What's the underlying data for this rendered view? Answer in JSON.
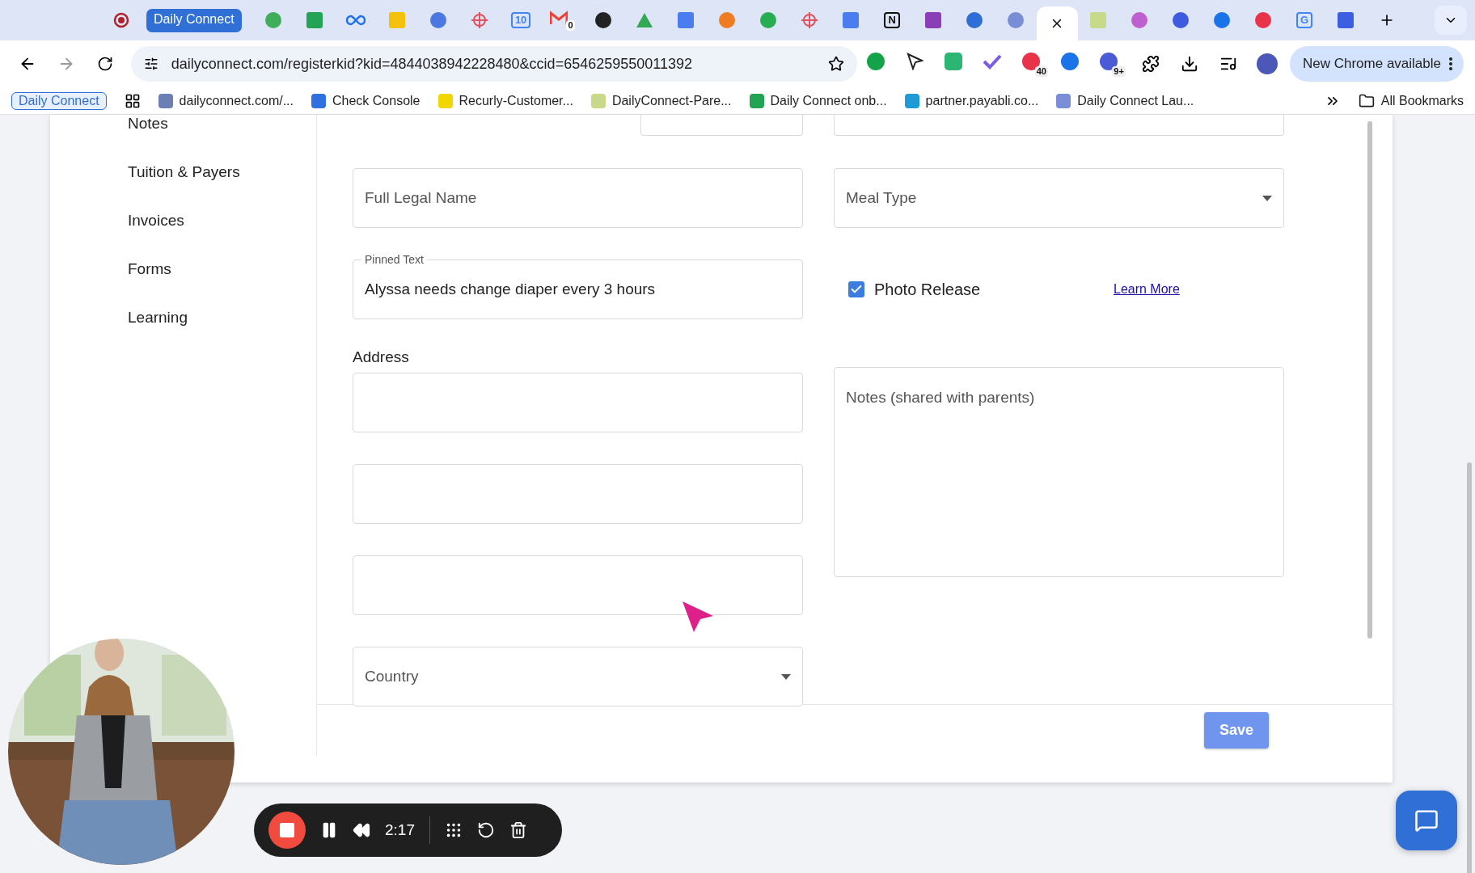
{
  "browser": {
    "tabs": [
      {
        "kind": "record",
        "color": "#b3202c"
      },
      {
        "kind": "group",
        "label": "Daily Connect"
      },
      {
        "kind": "circle",
        "color": "#3fae5a"
      },
      {
        "kind": "square",
        "color": "#23a455"
      },
      {
        "kind": "infinity",
        "color": "#1d6ff2"
      },
      {
        "kind": "square",
        "color": "#f4c20d"
      },
      {
        "kind": "circle",
        "color": "#4a78e0"
      },
      {
        "kind": "cross",
        "color": "#e0525e"
      },
      {
        "kind": "glyph",
        "color": "#4285f4",
        "glyph": "10"
      },
      {
        "kind": "mail",
        "color": "#ea4335",
        "glyph": "0"
      },
      {
        "kind": "circle",
        "color": "#222222"
      },
      {
        "kind": "triangle",
        "color": "#34a853"
      },
      {
        "kind": "square",
        "color": "#4a7ef0"
      },
      {
        "kind": "circle",
        "color": "#f07c22"
      },
      {
        "kind": "circle",
        "color": "#27ae52"
      },
      {
        "kind": "cross",
        "color": "#e0525e"
      },
      {
        "kind": "square",
        "color": "#4a7ef0"
      },
      {
        "kind": "glyph",
        "color": "#111111",
        "glyph": "N"
      },
      {
        "kind": "square",
        "color": "#8a3fb8"
      },
      {
        "kind": "circle",
        "color": "#2d6fd6"
      },
      {
        "kind": "circle",
        "color": "#7a8ed8"
      },
      {
        "kind": "active"
      },
      {
        "kind": "square",
        "color": "#c9d98a"
      },
      {
        "kind": "circle",
        "color": "#c05fd0"
      },
      {
        "kind": "circle",
        "color": "#3d5be0"
      },
      {
        "kind": "circle",
        "color": "#1a73e8"
      },
      {
        "kind": "circle",
        "color": "#e8334a"
      },
      {
        "kind": "glyph",
        "color": "#4285f4",
        "glyph": "G"
      },
      {
        "kind": "square",
        "color": "#3b5fe0"
      }
    ],
    "url": "dailyconnect.com/registerkid?kid=4844038942228480&ccid=6546259550011392",
    "extensions": [
      {
        "kind": "circle",
        "color": "#15a34a"
      },
      {
        "kind": "pointer",
        "color": "#222222"
      },
      {
        "kind": "square",
        "color": "#2bb673"
      },
      {
        "kind": "check",
        "color": "#7b5ce6"
      },
      {
        "kind": "circle",
        "color": "#e8334a",
        "badge": "40"
      },
      {
        "kind": "circle",
        "color": "#1a73e8"
      },
      {
        "kind": "circle",
        "color": "#4b5bd6",
        "badge": "9+"
      }
    ],
    "update_button": "New Chrome available",
    "bookmarks": [
      {
        "kind": "group",
        "label": "Daily Connect"
      },
      {
        "kind": "site",
        "label": "dailyconnect.com/...",
        "color": "#6b7fb5"
      },
      {
        "kind": "site",
        "label": "Check Console",
        "color": "#2f6fe0"
      },
      {
        "kind": "site",
        "label": "Recurly-Customer...",
        "color": "#f2d600"
      },
      {
        "kind": "site",
        "label": "DailyConnect-Pare...",
        "color": "#c9d98a"
      },
      {
        "kind": "site",
        "label": "Daily Connect onb...",
        "color": "#23a455"
      },
      {
        "kind": "site",
        "label": "partner.payabli.co...",
        "color": "#1e9bd7"
      },
      {
        "kind": "site",
        "label": "Daily Connect Lau...",
        "color": "#7a8ed8"
      }
    ],
    "all_bookmarks": "All Bookmarks"
  },
  "sidebar": {
    "items": [
      "Notes",
      "Tuition & Payers",
      "Invoices",
      "Forms",
      "Learning"
    ]
  },
  "form": {
    "rows": [
      {
        "left": {
          "kind": "stub"
        },
        "right": {
          "kind": "stub"
        }
      },
      {
        "left": {
          "kind": "text",
          "placeholder": "Full Legal Name"
        },
        "right": {
          "kind": "select",
          "placeholder": "Meal Type"
        }
      },
      {
        "left": {
          "kind": "pinned",
          "label": "Pinned Text",
          "value": "Alyssa needs change diaper every 3 hours"
        },
        "right": {
          "kind": "checkbox",
          "label": "Photo Release",
          "checked": true,
          "link": "Learn More"
        }
      }
    ],
    "address": {
      "label": "Address",
      "fields": [
        {
          "kind": "text"
        },
        {
          "kind": "text"
        },
        {
          "kind": "text"
        },
        {
          "kind": "select",
          "placeholder": "Country"
        }
      ]
    },
    "notes": {
      "placeholder": "Notes (shared with parents)"
    },
    "save_button": "Save"
  },
  "recorder": {
    "time": "2:17"
  }
}
